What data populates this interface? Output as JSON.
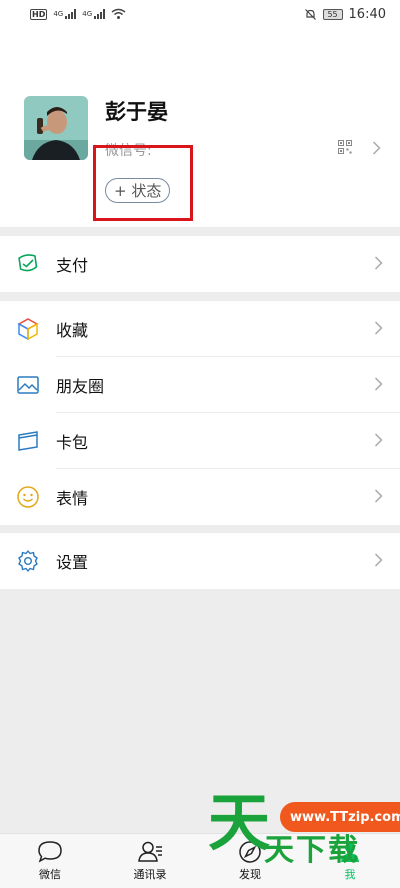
{
  "status_bar": {
    "network_1": "4G",
    "network_2": "4G",
    "battery": "55",
    "time": "16:40"
  },
  "profile": {
    "name": "彭于晏",
    "wechat_id_label": "微信号:",
    "status_button_label": "+ 状态"
  },
  "menu": [
    {
      "label": "支付",
      "icon": "wallet-icon"
    },
    {
      "label": "收藏",
      "icon": "favorites-cube-icon"
    },
    {
      "label": "朋友圈",
      "icon": "moments-image-icon"
    },
    {
      "label": "卡包",
      "icon": "card-icon"
    },
    {
      "label": "表情",
      "icon": "sticker-smile-icon"
    },
    {
      "label": "设置",
      "icon": "gear-icon"
    }
  ],
  "tabbar": [
    {
      "label": "微信",
      "icon": "chat-bubble-icon"
    },
    {
      "label": "通讯录",
      "icon": "contacts-icon"
    },
    {
      "label": "发现",
      "icon": "compass-icon"
    },
    {
      "label": "我",
      "icon": "person-icon",
      "active": true
    }
  ],
  "watermark": {
    "big_char": "天",
    "site": "www.TTzip.com",
    "name": "天下载"
  },
  "colors": {
    "accent_green": "#07c160",
    "highlight_red": "#d9141b",
    "watermark_green": "#1aa33a",
    "watermark_orange": "#f0581e"
  }
}
